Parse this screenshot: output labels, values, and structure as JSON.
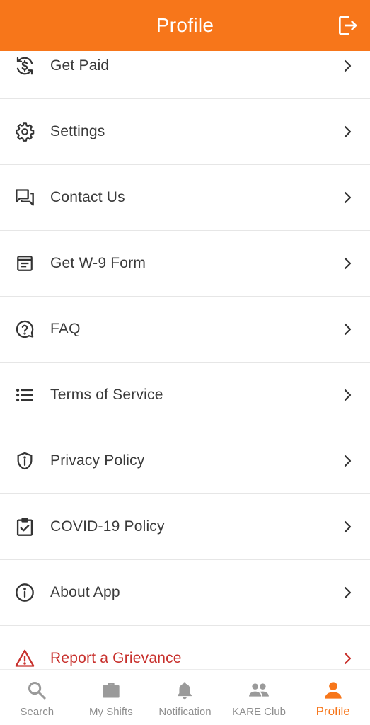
{
  "header": {
    "title": "Profile",
    "logout_icon": "logout-icon"
  },
  "menu": {
    "items": [
      {
        "label": "Get Paid",
        "icon": "dollar-refresh-icon"
      },
      {
        "label": "Settings",
        "icon": "gear-icon"
      },
      {
        "label": "Contact Us",
        "icon": "chat-icon"
      },
      {
        "label": "Get W-9 Form",
        "icon": "form-icon"
      },
      {
        "label": "FAQ",
        "icon": "help-circle-icon"
      },
      {
        "label": "Terms of Service",
        "icon": "list-icon"
      },
      {
        "label": "Privacy Policy",
        "icon": "shield-icon"
      },
      {
        "label": "COVID-19 Policy",
        "icon": "clipboard-check-icon"
      },
      {
        "label": "About App",
        "icon": "info-icon"
      },
      {
        "label": "Report a Grievance",
        "icon": "warning-icon"
      }
    ]
  },
  "tabbar": {
    "tabs": [
      {
        "label": "Search",
        "icon": "search-icon"
      },
      {
        "label": "My Shifts",
        "icon": "briefcase-icon"
      },
      {
        "label": "Notification",
        "icon": "bell-icon"
      },
      {
        "label": "KARE Club",
        "icon": "people-icon"
      },
      {
        "label": "Profile",
        "icon": "person-icon",
        "active": true
      }
    ]
  },
  "colors": {
    "accent": "#f7761a",
    "danger": "#c8302c",
    "text": "#3a3a3a",
    "inactive": "#8e8e8e"
  }
}
